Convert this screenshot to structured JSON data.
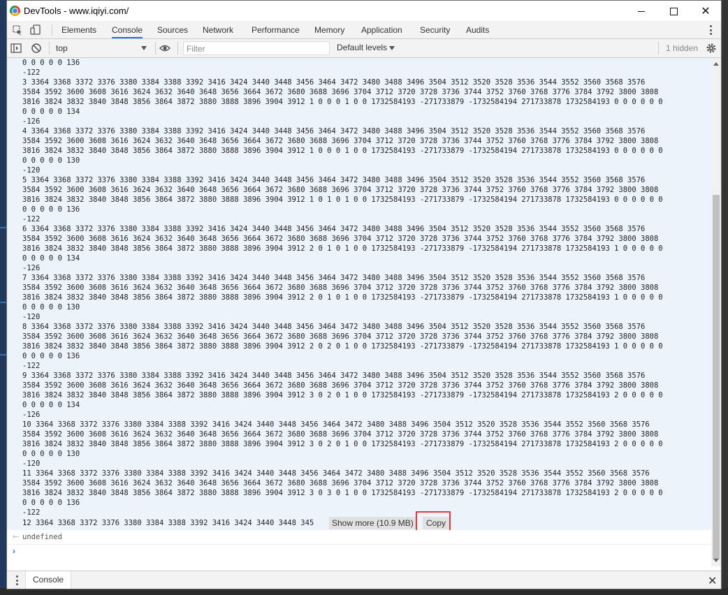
{
  "window": {
    "title": "DevTools - www.iqiyi.com/"
  },
  "tabs": [
    "Elements",
    "Console",
    "Sources",
    "Network",
    "Performance",
    "Memory",
    "Application",
    "Security",
    "Audits"
  ],
  "active_tab": "Console",
  "console_toolbar": {
    "context": "top",
    "filter_placeholder": "Filter",
    "levels": "Default levels",
    "hidden": "1 hidden"
  },
  "log_lines": [
    "0 0 0 0 0 136",
    "-122",
    "3 3364 3368 3372 3376 3380 3384 3388 3392 3416 3424 3440 3448 3456 3464 3472 3480 3488 3496 3504 3512 3520 3528 3536 3544 3552 3560 3568 3576",
    "3584 3592 3600 3608 3616 3624 3632 3640 3648 3656 3664 3672 3680 3688 3696 3704 3712 3720 3728 3736 3744 3752 3760 3768 3776 3784 3792 3800 3808",
    "3816 3824 3832 3840 3848 3856 3864 3872 3880 3888 3896 3904 3912 1 0 0 0 1 0 0 1732584193 -271733879 -1732584194 271733878 1732584193 0 0 0 0 0 0",
    "0 0 0 0 0 134",
    "-126",
    "4 3364 3368 3372 3376 3380 3384 3388 3392 3416 3424 3440 3448 3456 3464 3472 3480 3488 3496 3504 3512 3520 3528 3536 3544 3552 3560 3568 3576",
    "3584 3592 3600 3608 3616 3624 3632 3640 3648 3656 3664 3672 3680 3688 3696 3704 3712 3720 3728 3736 3744 3752 3760 3768 3776 3784 3792 3800 3808",
    "3816 3824 3832 3840 3848 3856 3864 3872 3880 3888 3896 3904 3912 1 0 0 0 1 0 0 1732584193 -271733879 -1732584194 271733878 1732584193 0 0 0 0 0 0",
    "0 0 0 0 0 130",
    "-120",
    "5 3364 3368 3372 3376 3380 3384 3388 3392 3416 3424 3440 3448 3456 3464 3472 3480 3488 3496 3504 3512 3520 3528 3536 3544 3552 3560 3568 3576",
    "3584 3592 3600 3608 3616 3624 3632 3640 3648 3656 3664 3672 3680 3688 3696 3704 3712 3720 3728 3736 3744 3752 3760 3768 3776 3784 3792 3800 3808",
    "3816 3824 3832 3840 3848 3856 3864 3872 3880 3888 3896 3904 3912 1 0 1 0 1 0 0 1732584193 -271733879 -1732584194 271733878 1732584193 0 0 0 0 0 0",
    "0 0 0 0 0 136",
    "-122",
    "6 3364 3368 3372 3376 3380 3384 3388 3392 3416 3424 3440 3448 3456 3464 3472 3480 3488 3496 3504 3512 3520 3528 3536 3544 3552 3560 3568 3576",
    "3584 3592 3600 3608 3616 3624 3632 3640 3648 3656 3664 3672 3680 3688 3696 3704 3712 3720 3728 3736 3744 3752 3760 3768 3776 3784 3792 3800 3808",
    "3816 3824 3832 3840 3848 3856 3864 3872 3880 3888 3896 3904 3912 2 0 1 0 1 0 0 1732584193 -271733879 -1732584194 271733878 1732584193 1 0 0 0 0 0",
    "0 0 0 0 0 134",
    "-126",
    "7 3364 3368 3372 3376 3380 3384 3388 3392 3416 3424 3440 3448 3456 3464 3472 3480 3488 3496 3504 3512 3520 3528 3536 3544 3552 3560 3568 3576",
    "3584 3592 3600 3608 3616 3624 3632 3640 3648 3656 3664 3672 3680 3688 3696 3704 3712 3720 3728 3736 3744 3752 3760 3768 3776 3784 3792 3800 3808",
    "3816 3824 3832 3840 3848 3856 3864 3872 3880 3888 3896 3904 3912 2 0 1 0 1 0 0 1732584193 -271733879 -1732584194 271733878 1732584193 1 0 0 0 0 0",
    "0 0 0 0 0 130",
    "-120",
    "8 3364 3368 3372 3376 3380 3384 3388 3392 3416 3424 3440 3448 3456 3464 3472 3480 3488 3496 3504 3512 3520 3528 3536 3544 3552 3560 3568 3576",
    "3584 3592 3600 3608 3616 3624 3632 3640 3648 3656 3664 3672 3680 3688 3696 3704 3712 3720 3728 3736 3744 3752 3760 3768 3776 3784 3792 3800 3808",
    "3816 3824 3832 3840 3848 3856 3864 3872 3880 3888 3896 3904 3912 2 0 2 0 1 0 0 1732584193 -271733879 -1732584194 271733878 1732584193 1 0 0 0 0 0",
    "0 0 0 0 0 136",
    "-122",
    "9 3364 3368 3372 3376 3380 3384 3388 3392 3416 3424 3440 3448 3456 3464 3472 3480 3488 3496 3504 3512 3520 3528 3536 3544 3552 3560 3568 3576",
    "3584 3592 3600 3608 3616 3624 3632 3640 3648 3656 3664 3672 3680 3688 3696 3704 3712 3720 3728 3736 3744 3752 3760 3768 3776 3784 3792 3800 3808",
    "3816 3824 3832 3840 3848 3856 3864 3872 3880 3888 3896 3904 3912 3 0 2 0 1 0 0 1732584193 -271733879 -1732584194 271733878 1732584193 2 0 0 0 0 0",
    "0 0 0 0 0 134",
    "-126",
    "10 3364 3368 3372 3376 3380 3384 3388 3392 3416 3424 3440 3448 3456 3464 3472 3480 3488 3496 3504 3512 3520 3528 3536 3544 3552 3560 3568 3576",
    "3584 3592 3600 3608 3616 3624 3632 3640 3648 3656 3664 3672 3680 3688 3696 3704 3712 3720 3728 3736 3744 3752 3760 3768 3776 3784 3792 3800 3808",
    "3816 3824 3832 3840 3848 3856 3864 3872 3880 3888 3896 3904 3912 3 0 2 0 1 0 0 1732584193 -271733879 -1732584194 271733878 1732584193 2 0 0 0 0 0",
    "0 0 0 0 0 130",
    "-120",
    "11 3364 3368 3372 3376 3380 3384 3388 3392 3416 3424 3440 3448 3456 3464 3472 3480 3488 3496 3504 3512 3520 3528 3536 3544 3552 3560 3568 3576",
    "3584 3592 3600 3608 3616 3624 3632 3640 3648 3656 3664 3672 3680 3688 3696 3704 3712 3720 3728 3736 3744 3752 3760 3768 3776 3784 3792 3800 3808",
    "3816 3824 3832 3840 3848 3856 3864 3872 3880 3888 3896 3904 3912 3 0 3 0 1 0 0 1732584193 -271733879 -1732584194 271733878 1732584193 2 0 0 0 0 0",
    "0 0 0 0 0 136",
    "-122"
  ],
  "truncated_line": "12 3364 3368 3372 3376 3380 3384 3388 3392 3416 3424 3440 3448 345",
  "show_more_label": "Show more (10.9 MB)",
  "copy_label": "Copy",
  "result_text": "undefined",
  "drawer": {
    "tab": "Console"
  },
  "colors": {
    "accent": "#1a73e8",
    "highlight": "#e53935",
    "log_bg": "#edf3fb"
  },
  "icons": [
    "dock-side-icon",
    "device-toolbar-icon",
    "sidebar-toggle-icon",
    "clear-console-icon",
    "eye-icon",
    "settings-gear-icon"
  ]
}
